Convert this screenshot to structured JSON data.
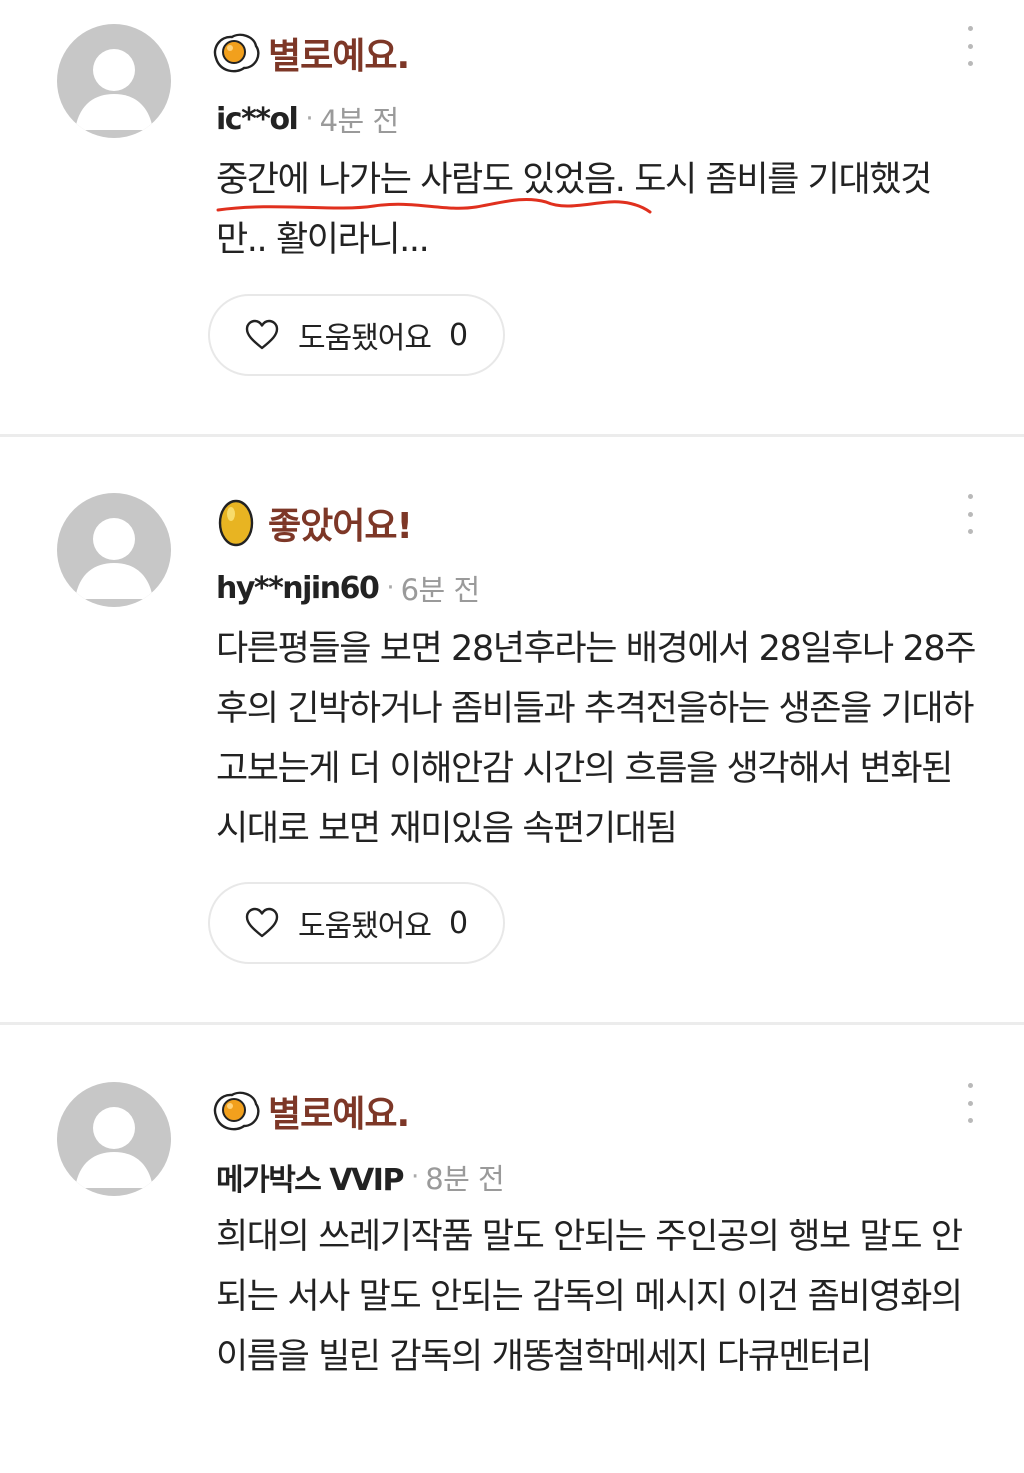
{
  "reviews": [
    {
      "rating_icon": "fried-egg-icon",
      "rating_label": "별로예요.",
      "username": "ic**ol",
      "time": "4분 전",
      "text": "중간에 나가는 사람도 있었음. 도시 좀비를 기대했것만.. 활이라니...",
      "helpful_label": "도움됐어요",
      "helpful_count": "0"
    },
    {
      "rating_icon": "golden-egg-icon",
      "rating_label": "좋았어요!",
      "username": "hy**njin60",
      "time": "6분 전",
      "text": "다른평들을 보면 28년후라는 배경에서 28일후나 28주후의 긴박하거나 좀비들과 추격전을하는 생존을 기대하고보는게 더 이해안감 시간의 흐름을 생각해서 변화된 시대로 보면 재미있음 속편기대됨",
      "helpful_label": "도움됐어요",
      "helpful_count": "0"
    },
    {
      "rating_icon": "fried-egg-icon",
      "rating_label": "별로예요.",
      "username": "메가박스 VVIP",
      "time": "8분 전",
      "text": "희대의 쓰레기작품 말도 안되는 주인공의 행보 말도 안되는 서사 말도 안되는 감독의 메시지 이건 좀비영화의 이름을 빌린 감독의 개똥철학메세지 다큐멘터리"
    }
  ],
  "meta_separator": "·",
  "colors": {
    "rating_label": "#7d3727",
    "avatar_bg": "#c7c7c7",
    "underline_annotation": "#e0301e",
    "divider": "#ececec",
    "egg_yolk": "#f2a01d",
    "golden_egg": "#e8b422"
  }
}
